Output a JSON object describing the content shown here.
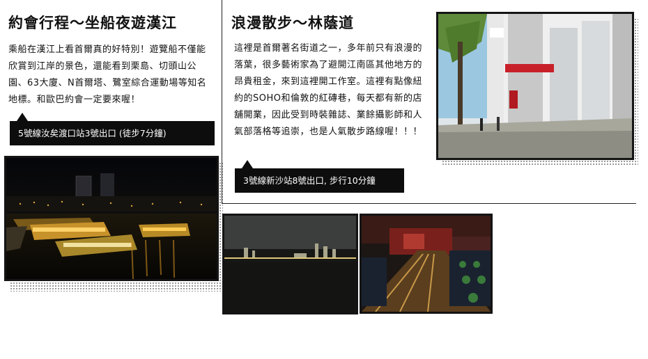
{
  "left": {
    "title": "約會行程～坐船夜遊漢江",
    "body": "乘船在漢江上看首爾真的好特別！遊覽船不僅能欣賞到江岸的景色，還能看到栗島、切頭山公園、63大廈、N首爾塔、鷺室綜合運動場等知名地標。和歐巴約會一定要來喔！",
    "direction": "5號線汝矣渡口站3號出口 (徒步7分鐘)"
  },
  "right": {
    "title": "浪漫散步～林蔭道",
    "body": "這裡是首爾著名街道之一，多年前只有浪漫的落葉，很多藝術家為了避開江南區其他地方的昂貴租金，來到這裡開工作室。這裡有點像紐約的SOHO和倫敦的紅磚巷，每天都有新的店舖開業，因此受到時裝雜誌、業餘攝影師和人氣部落格等追崇，也是人氣散步路線喔！！！",
    "direction": "3號線新沙站8號出口, 步行10分鐘"
  },
  "icons": {
    "left_tag_pointer": "speech-pointer-icon",
    "right_tag_pointer": "speech-pointer-icon"
  },
  "colors": {
    "tag_bg": "#0d0d0d",
    "text": "#111111"
  }
}
